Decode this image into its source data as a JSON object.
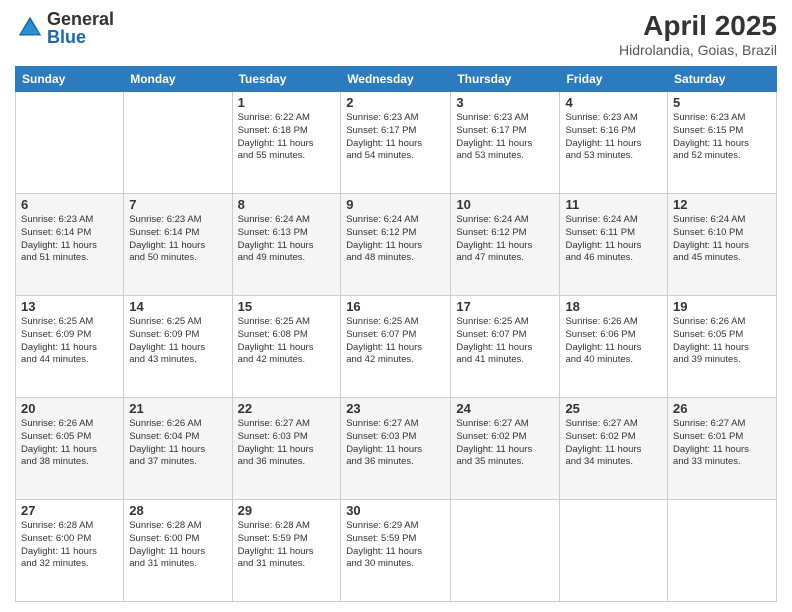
{
  "logo": {
    "general": "General",
    "blue": "Blue"
  },
  "header": {
    "month_year": "April 2025",
    "location": "Hidrolandia, Goias, Brazil"
  },
  "weekdays": [
    "Sunday",
    "Monday",
    "Tuesday",
    "Wednesday",
    "Thursday",
    "Friday",
    "Saturday"
  ],
  "weeks": [
    [
      {
        "day": "",
        "info": ""
      },
      {
        "day": "",
        "info": ""
      },
      {
        "day": "1",
        "info": "Sunrise: 6:22 AM\nSunset: 6:18 PM\nDaylight: 11 hours\nand 55 minutes."
      },
      {
        "day": "2",
        "info": "Sunrise: 6:23 AM\nSunset: 6:17 PM\nDaylight: 11 hours\nand 54 minutes."
      },
      {
        "day": "3",
        "info": "Sunrise: 6:23 AM\nSunset: 6:17 PM\nDaylight: 11 hours\nand 53 minutes."
      },
      {
        "day": "4",
        "info": "Sunrise: 6:23 AM\nSunset: 6:16 PM\nDaylight: 11 hours\nand 53 minutes."
      },
      {
        "day": "5",
        "info": "Sunrise: 6:23 AM\nSunset: 6:15 PM\nDaylight: 11 hours\nand 52 minutes."
      }
    ],
    [
      {
        "day": "6",
        "info": "Sunrise: 6:23 AM\nSunset: 6:14 PM\nDaylight: 11 hours\nand 51 minutes."
      },
      {
        "day": "7",
        "info": "Sunrise: 6:23 AM\nSunset: 6:14 PM\nDaylight: 11 hours\nand 50 minutes."
      },
      {
        "day": "8",
        "info": "Sunrise: 6:24 AM\nSunset: 6:13 PM\nDaylight: 11 hours\nand 49 minutes."
      },
      {
        "day": "9",
        "info": "Sunrise: 6:24 AM\nSunset: 6:12 PM\nDaylight: 11 hours\nand 48 minutes."
      },
      {
        "day": "10",
        "info": "Sunrise: 6:24 AM\nSunset: 6:12 PM\nDaylight: 11 hours\nand 47 minutes."
      },
      {
        "day": "11",
        "info": "Sunrise: 6:24 AM\nSunset: 6:11 PM\nDaylight: 11 hours\nand 46 minutes."
      },
      {
        "day": "12",
        "info": "Sunrise: 6:24 AM\nSunset: 6:10 PM\nDaylight: 11 hours\nand 45 minutes."
      }
    ],
    [
      {
        "day": "13",
        "info": "Sunrise: 6:25 AM\nSunset: 6:09 PM\nDaylight: 11 hours\nand 44 minutes."
      },
      {
        "day": "14",
        "info": "Sunrise: 6:25 AM\nSunset: 6:09 PM\nDaylight: 11 hours\nand 43 minutes."
      },
      {
        "day": "15",
        "info": "Sunrise: 6:25 AM\nSunset: 6:08 PM\nDaylight: 11 hours\nand 42 minutes."
      },
      {
        "day": "16",
        "info": "Sunrise: 6:25 AM\nSunset: 6:07 PM\nDaylight: 11 hours\nand 42 minutes."
      },
      {
        "day": "17",
        "info": "Sunrise: 6:25 AM\nSunset: 6:07 PM\nDaylight: 11 hours\nand 41 minutes."
      },
      {
        "day": "18",
        "info": "Sunrise: 6:26 AM\nSunset: 6:06 PM\nDaylight: 11 hours\nand 40 minutes."
      },
      {
        "day": "19",
        "info": "Sunrise: 6:26 AM\nSunset: 6:05 PM\nDaylight: 11 hours\nand 39 minutes."
      }
    ],
    [
      {
        "day": "20",
        "info": "Sunrise: 6:26 AM\nSunset: 6:05 PM\nDaylight: 11 hours\nand 38 minutes."
      },
      {
        "day": "21",
        "info": "Sunrise: 6:26 AM\nSunset: 6:04 PM\nDaylight: 11 hours\nand 37 minutes."
      },
      {
        "day": "22",
        "info": "Sunrise: 6:27 AM\nSunset: 6:03 PM\nDaylight: 11 hours\nand 36 minutes."
      },
      {
        "day": "23",
        "info": "Sunrise: 6:27 AM\nSunset: 6:03 PM\nDaylight: 11 hours\nand 36 minutes."
      },
      {
        "day": "24",
        "info": "Sunrise: 6:27 AM\nSunset: 6:02 PM\nDaylight: 11 hours\nand 35 minutes."
      },
      {
        "day": "25",
        "info": "Sunrise: 6:27 AM\nSunset: 6:02 PM\nDaylight: 11 hours\nand 34 minutes."
      },
      {
        "day": "26",
        "info": "Sunrise: 6:27 AM\nSunset: 6:01 PM\nDaylight: 11 hours\nand 33 minutes."
      }
    ],
    [
      {
        "day": "27",
        "info": "Sunrise: 6:28 AM\nSunset: 6:00 PM\nDaylight: 11 hours\nand 32 minutes."
      },
      {
        "day": "28",
        "info": "Sunrise: 6:28 AM\nSunset: 6:00 PM\nDaylight: 11 hours\nand 31 minutes."
      },
      {
        "day": "29",
        "info": "Sunrise: 6:28 AM\nSunset: 5:59 PM\nDaylight: 11 hours\nand 31 minutes."
      },
      {
        "day": "30",
        "info": "Sunrise: 6:29 AM\nSunset: 5:59 PM\nDaylight: 11 hours\nand 30 minutes."
      },
      {
        "day": "",
        "info": ""
      },
      {
        "day": "",
        "info": ""
      },
      {
        "day": "",
        "info": ""
      }
    ]
  ]
}
